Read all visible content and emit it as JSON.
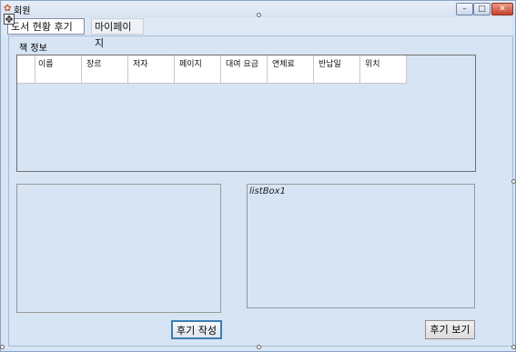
{
  "window": {
    "title": "회원",
    "app_icon": "app-icon",
    "controls": {
      "minimize": "–",
      "maximize": "□",
      "close": "✕"
    }
  },
  "menu": {
    "items": [
      {
        "label": "도서 현황 후기"
      },
      {
        "label": "마이페이지"
      }
    ]
  },
  "section": {
    "label": "책 정보"
  },
  "grid": {
    "columns": [
      "이름",
      "장르",
      "저자",
      "페이지",
      "대여 요금",
      "연체료",
      "반납일",
      "위치"
    ]
  },
  "listbox": {
    "name": "listBox1"
  },
  "buttons": {
    "write_review": "후기 작성",
    "view_review": "후기 보기"
  },
  "colors": {
    "form_background": "#d6e4f4",
    "focus_border": "#3c7fb1"
  }
}
